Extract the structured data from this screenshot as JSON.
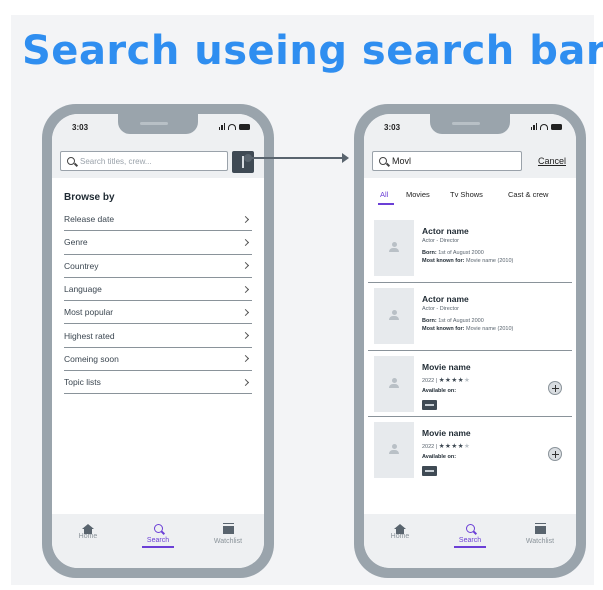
{
  "headline": "Search useing search bar",
  "colors": {
    "accent": "#2f8ef0",
    "active_tab": "#6b3fd6",
    "phone_frame": "#9aa4ac"
  },
  "left_screen": {
    "status_time": "3:03",
    "search_placeholder": "Search titles, crew...",
    "filter_icon": "filter-icon",
    "browse_title": "Browse by",
    "browse_items": [
      {
        "label": "Release date"
      },
      {
        "label": "Genre"
      },
      {
        "label": "Countrey"
      },
      {
        "label": "Language"
      },
      {
        "label": "Most popular"
      },
      {
        "label": "Highest rated"
      },
      {
        "label": "Comeing soon"
      },
      {
        "label": "Topic lists"
      }
    ],
    "tabs": {
      "home": "Home",
      "search": "Search",
      "watchlist": "Watchlist"
    }
  },
  "right_screen": {
    "status_time": "3:03",
    "search_value": "Movl",
    "cancel_label": "Cancel",
    "filter_tabs": {
      "all": "All",
      "movies": "Movies",
      "tv": "Tv Shows",
      "cast": "Cast & crew"
    },
    "results": [
      {
        "title": "Actor name",
        "role": "Actor - Director",
        "born_label": "Born:",
        "born": "1st of August 2000",
        "known_label": "Most known for:",
        "known": "Movie name (2010)"
      },
      {
        "title": "Actor name",
        "role": "Actor - Director",
        "born_label": "Born:",
        "born": "1st of August 2000",
        "known_label": "Most known for:",
        "known": "Movie name (2010)"
      },
      {
        "title": "Movie name",
        "year": "2022 |",
        "rating": 4,
        "available_label": "Available on:"
      },
      {
        "title": "Movie name",
        "year": "2022 |",
        "rating": 4,
        "available_label": "Available on:"
      }
    ],
    "tabs": {
      "home": "Home",
      "search": "Search",
      "watchlist": "Watchlist"
    }
  }
}
